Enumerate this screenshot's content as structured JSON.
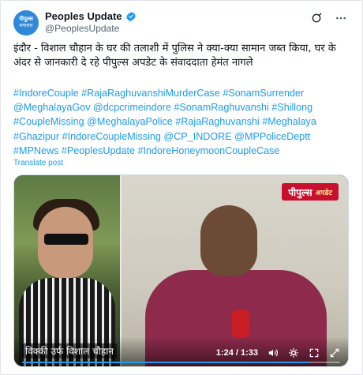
{
  "account": {
    "avatar_text": "पीपुल्स",
    "avatar_sub": "समाचार",
    "display_name": "Peoples Update",
    "handle": "@PeoplesUpdate"
  },
  "top_actions": {
    "grok_icon": "grok-icon",
    "more_icon": "more-icon"
  },
  "tweet": {
    "text": "इंदौर - विशाल चौहान के घर की तलाशी में पुलिस ने क्या-क्या सामान जब्त किया, घर के अंदर से जानकारी दे रहे पीपुल्स अपडेट के संवाददाता हेमंत नागले",
    "hashtags": "#IndoreCouple #RajaRaghuvanshiMurderCase #SonamSurrender @MeghalayaGov @dcpcrimeindore #SonamRaghuvanshi #Shillong #CoupleMissing @MeghalayaPolice #RajaRaghuvanshi #Meghalaya #Ghazipur #IndoreCoupleMissing @CP_INDORE @MPPoliceDeptt #MPNews #PeoplesUpdate #IndoreHoneymoonCoupleCase",
    "translate_label": "Translate post"
  },
  "video": {
    "brand_logo": "पीपुल्स",
    "brand_tag": "अपडेट",
    "caption": "विक्की उर्फ विशाल चौहान",
    "time": "1:24 / 1:33",
    "progress": 0.903,
    "icons": [
      "volume-icon",
      "settings-icon",
      "fullscreen-icon",
      "expand-icon"
    ]
  },
  "colors": {
    "link": "#1d9bf0",
    "verified": "#1d9bf0",
    "brand_red": "#c8102e"
  }
}
